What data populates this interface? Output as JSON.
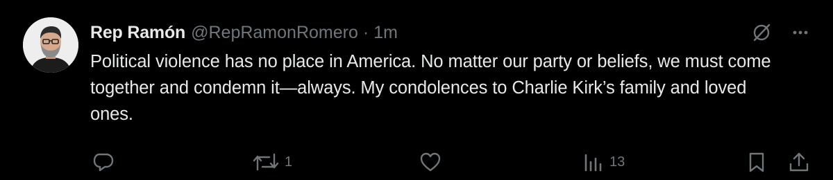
{
  "tweet": {
    "display_name": "Rep Ramón",
    "handle": "@RepRamonRomero",
    "separator": "·",
    "time": "1m",
    "text": "Political violence has no place in America. No matter our party or beliefs, we must come together and condemn it—always. My condolences to Charlie Kirk’s family and loved ones."
  },
  "actions": {
    "reply_count": "",
    "repost_count": "1",
    "like_count": "",
    "views_count": "13"
  },
  "icons": {
    "grok": "grok-icon",
    "more": "more-icon",
    "reply": "reply-icon",
    "repost": "repost-icon",
    "like": "like-icon",
    "views": "views-icon",
    "bookmark": "bookmark-icon",
    "share": "share-icon"
  },
  "colors": {
    "background": "#000000",
    "text_primary": "#e7e9ea",
    "text_secondary": "#71767b"
  }
}
